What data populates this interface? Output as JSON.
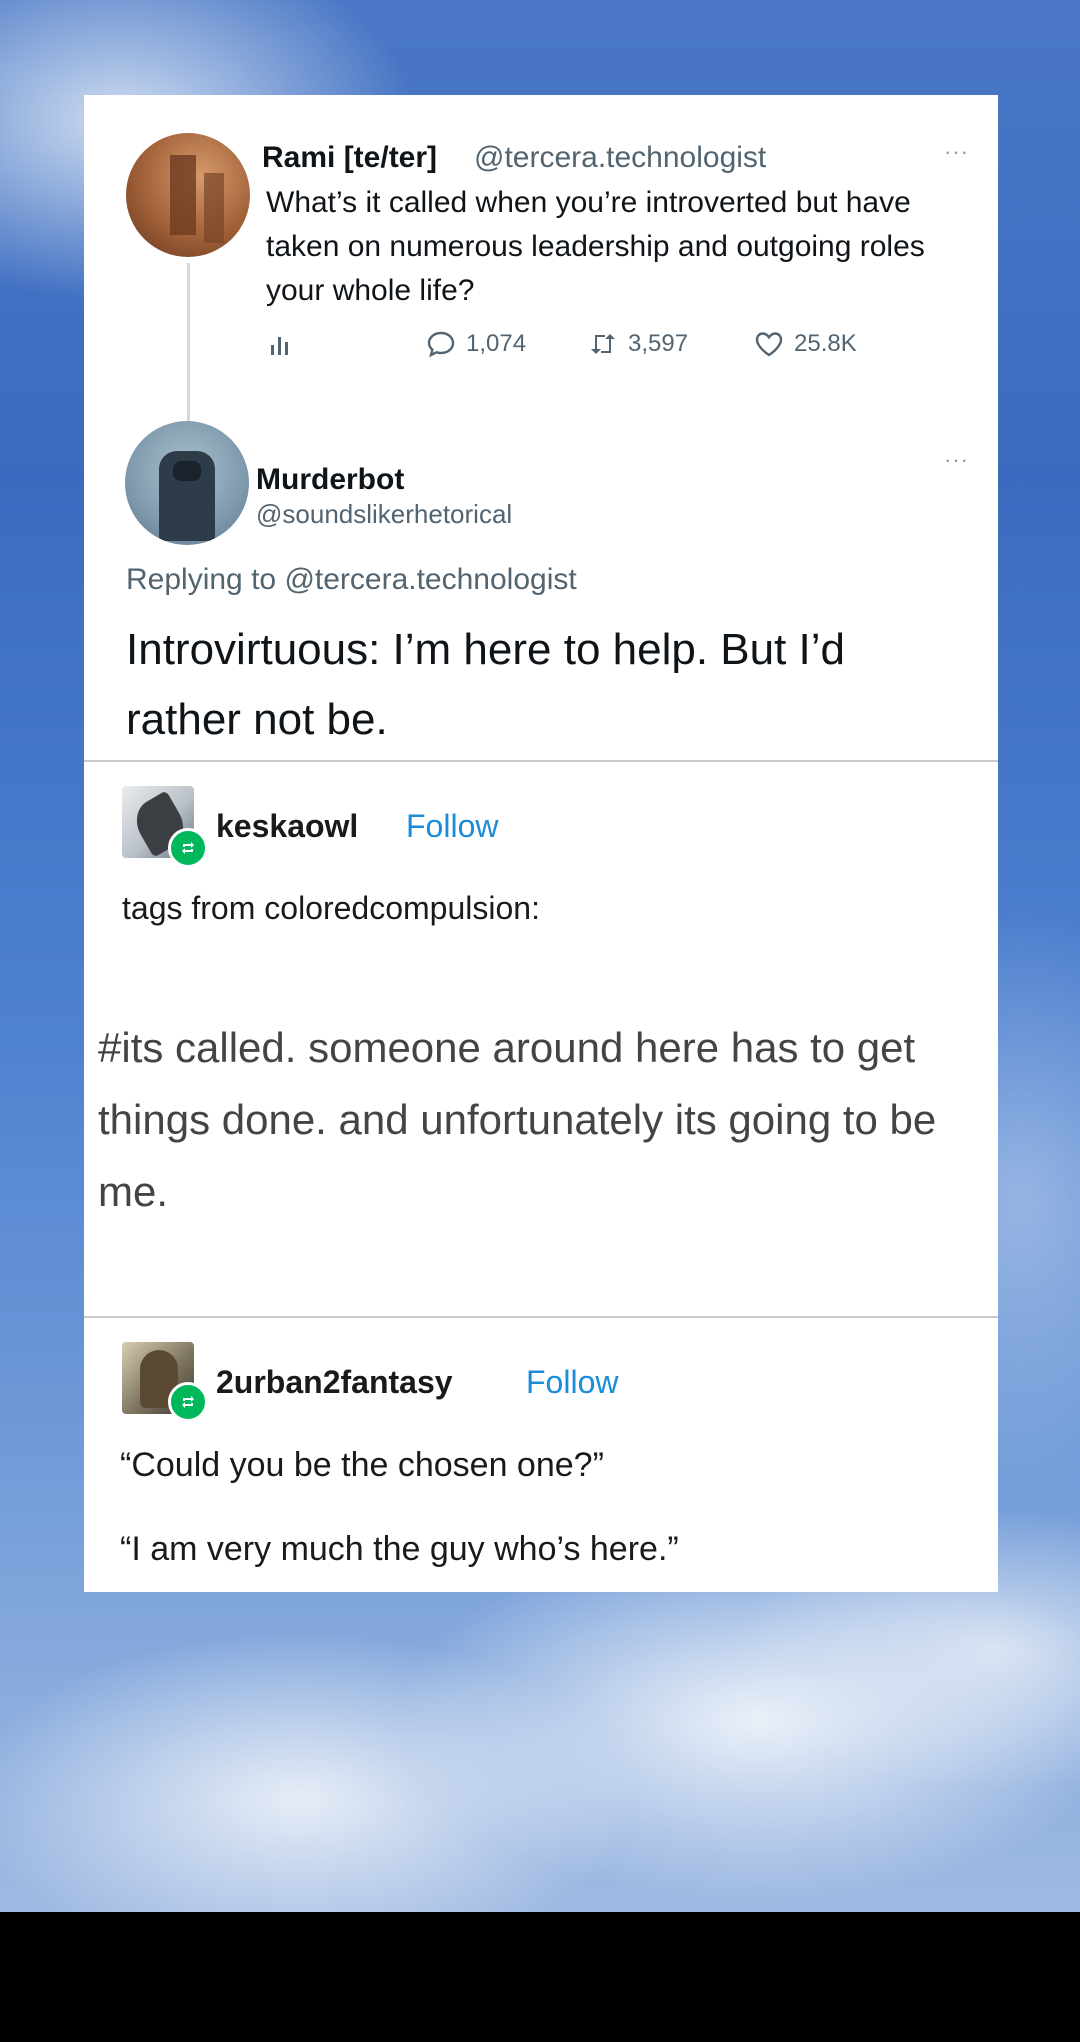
{
  "tweet": {
    "original": {
      "name": "Rami [te/ter]",
      "handle": "@tercera.technologist",
      "more": "···",
      "text": "What’s it called when you’re introverted but have taken on numerous leadership and outgoing roles your whole life?",
      "stats": {
        "replies": "1,074",
        "retweets": "3,597",
        "likes": "25.8K"
      }
    },
    "reply": {
      "name": "Murderbot",
      "handle": "@soundslikerhetorical",
      "more": "···",
      "replying_to_prefix": "Replying to",
      "replying_to_handle": "@tercera.technologist",
      "text": "Introvirtuous: I’m here to help. But I’d rather not be."
    }
  },
  "tumblr_posts": [
    {
      "username": "keskaowl",
      "follow_label": "Follow",
      "intro": "tags from coloredcompulsion:",
      "body": "#its called. someone around here has to get things done. and  unfortunately its going to be me."
    },
    {
      "username": "2urban2fantasy",
      "follow_label": "Follow",
      "line1": "“Could you be the chosen one?”",
      "line2": "“I am very much the guy who’s here.”"
    }
  ],
  "colors": {
    "link_blue": "#1a8cd8",
    "reblog_green": "#00b85c"
  }
}
